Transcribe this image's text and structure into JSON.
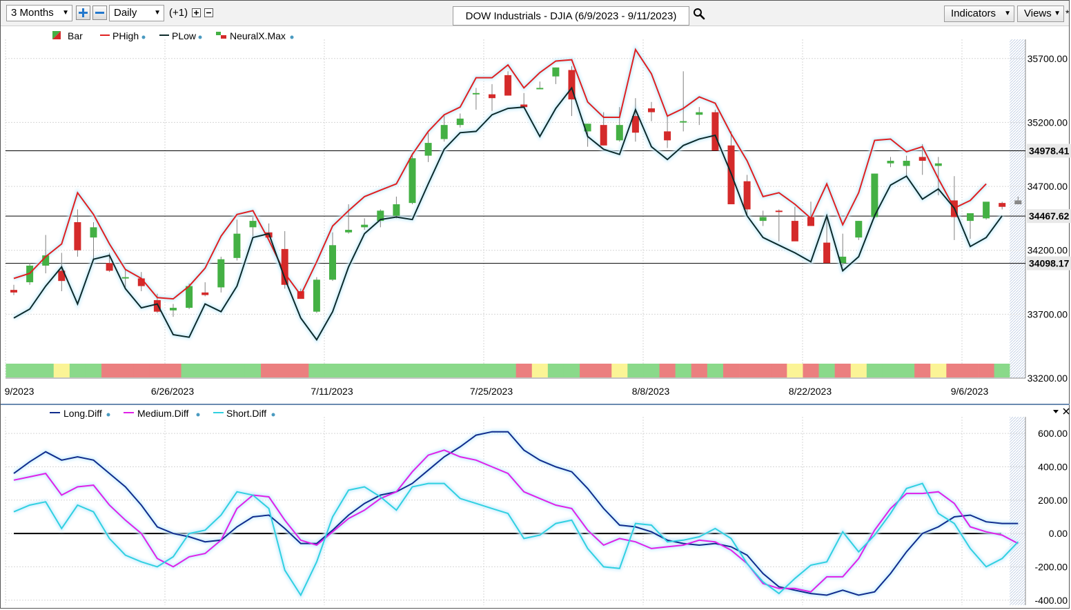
{
  "toolbar": {
    "period": "3 Months",
    "interval": "Daily",
    "step": "(+1)",
    "title": "DOW Industrials - DJIA (6/9/2023 - 9/11/2023)",
    "indicators_label": "Indicators",
    "views_label": "Views",
    "more_label": "*",
    "zoom_in_icon": "plus-icon",
    "zoom_out_icon": "minus-icon",
    "search_icon": "magnifier-icon"
  },
  "colors": {
    "up": "#44b044",
    "down": "#d42a2a",
    "phigh": "#e02020",
    "plow": "#0d2a2a",
    "long": "#102c8c",
    "medium": "#e020e8",
    "short": "#30d0e0",
    "band_green": "#8ad98a",
    "band_red": "#eb7f7f",
    "band_yellow": "#fbf496"
  },
  "chart_data": [
    {
      "type": "candlestick",
      "legend": [
        "Bar",
        "PHigh",
        "PLow",
        "NeuralX.Max"
      ],
      "x_tick_labels": [
        "9/2023",
        "6/26/2023",
        "7/11/2023",
        "7/25/2023",
        "8/8/2023",
        "8/22/2023",
        "9/6/2023"
      ],
      "y_tick_labels": [
        "35700.00",
        "35200.00",
        "34700.00",
        "34200.00",
        "33700.00",
        "33200.00"
      ],
      "ylim": [
        33200,
        35850
      ],
      "horizontal_lines": [
        {
          "label": "34978.41",
          "value": 34978.41
        },
        {
          "label": "34467.62",
          "value": 34467.62
        },
        {
          "label": "34098.17",
          "value": 34098.17
        }
      ],
      "dates": [
        "6/9",
        "6/12",
        "6/13",
        "6/14",
        "6/15",
        "6/16",
        "6/20",
        "6/21",
        "6/22",
        "6/23",
        "6/26",
        "6/27",
        "6/28",
        "6/29",
        "6/30",
        "7/3",
        "7/5",
        "7/6",
        "7/7",
        "7/10",
        "7/11",
        "7/12",
        "7/13",
        "7/14",
        "7/17",
        "7/18",
        "7/19",
        "7/20",
        "7/21",
        "7/24",
        "7/25",
        "7/26",
        "7/27",
        "7/28",
        "7/31",
        "8/1",
        "8/2",
        "8/3",
        "8/4",
        "8/7",
        "8/8",
        "8/9",
        "8/10",
        "8/11",
        "8/14",
        "8/15",
        "8/16",
        "8/17",
        "8/18",
        "8/21",
        "8/22",
        "8/23",
        "8/24",
        "8/25",
        "8/28",
        "8/29",
        "8/30",
        "8/31",
        "9/1",
        "9/5",
        "9/6",
        "9/7",
        "9/8",
        "9/11"
      ],
      "open": [
        33890,
        33950,
        34080,
        34040,
        34420,
        34300,
        34100,
        33980,
        33980,
        33810,
        33730,
        33750,
        33870,
        33910,
        34140,
        34380,
        34340,
        34210,
        33880,
        33720,
        33970,
        34340,
        34380,
        34430,
        34470,
        34570,
        34940,
        35070,
        35180,
        35430,
        35420,
        35570,
        35340,
        35470,
        35560,
        35610,
        35130,
        35180,
        35060,
        35250,
        35310,
        35130,
        35200,
        35260,
        35280,
        35020,
        34740,
        34430,
        34510,
        34430,
        34460,
        34260,
        34100,
        34300,
        34460,
        34880,
        34860,
        34930,
        34860,
        34590,
        34430,
        34450,
        34570,
        34590
      ],
      "high": [
        33930,
        34100,
        34320,
        34180,
        34520,
        34420,
        34180,
        34050,
        34030,
        33860,
        33780,
        33940,
        33950,
        34150,
        34440,
        34460,
        34410,
        34350,
        33900,
        33990,
        34340,
        34560,
        34450,
        34520,
        34620,
        34960,
        35120,
        35260,
        35270,
        35470,
        35500,
        35600,
        35430,
        35520,
        35630,
        35640,
        35190,
        35280,
        35320,
        35390,
        35360,
        35250,
        35600,
        35320,
        35300,
        35130,
        34790,
        34510,
        34520,
        34540,
        34580,
        34450,
        34330,
        34430,
        34800,
        34930,
        34940,
        35030,
        34930,
        34780,
        34470,
        34570,
        34580,
        34620
      ],
      "low": [
        33850,
        33930,
        34020,
        33880,
        34150,
        34130,
        34030,
        33910,
        33880,
        33710,
        33680,
        33740,
        33840,
        33870,
        34120,
        34310,
        34300,
        33900,
        33840,
        33710,
        33960,
        34330,
        34360,
        34380,
        34450,
        34560,
        34890,
        35050,
        35160,
        35300,
        35290,
        35410,
        35320,
        35460,
        35500,
        35250,
        35010,
        35020,
        35050,
        35050,
        35210,
        35000,
        35130,
        35180,
        35150,
        34940,
        34470,
        34390,
        34270,
        34320,
        34390,
        34110,
        34080,
        34280,
        34450,
        34850,
        34780,
        34790,
        34630,
        34280,
        34290,
        34440,
        34520,
        34560
      ],
      "close": [
        33870,
        34080,
        34160,
        33960,
        34200,
        34380,
        34040,
        33990,
        33920,
        33720,
        33750,
        33920,
        33850,
        34130,
        34330,
        34430,
        34300,
        33930,
        33820,
        33970,
        34240,
        34360,
        34400,
        34510,
        34560,
        34920,
        35040,
        35180,
        35230,
        35430,
        35390,
        35410,
        35320,
        35470,
        35630,
        35380,
        35190,
        35020,
        35180,
        35120,
        35280,
        35060,
        35210,
        35280,
        34980,
        34560,
        34520,
        34460,
        34500,
        34270,
        34390,
        34100,
        34150,
        34430,
        34800,
        34900,
        34900,
        34900,
        34880,
        34460,
        34490,
        34580,
        34540,
        34560
      ],
      "phigh": [
        33980,
        34020,
        34150,
        34250,
        34650,
        34480,
        34250,
        34050,
        33980,
        33830,
        33820,
        33920,
        34060,
        34310,
        34480,
        34510,
        34280,
        34020,
        33850,
        34110,
        34390,
        34510,
        34620,
        34670,
        34720,
        34950,
        35130,
        35260,
        35320,
        35550,
        35550,
        35650,
        35470,
        35590,
        35680,
        35690,
        35360,
        35240,
        35240,
        35770,
        35580,
        35250,
        35310,
        35400,
        35350,
        35110,
        34900,
        34620,
        34650,
        34560,
        34450,
        34720,
        34400,
        34650,
        35060,
        35070,
        34970,
        35010,
        34760,
        34530,
        34590,
        34720
      ],
      "plow": [
        33670,
        33740,
        33920,
        34070,
        33780,
        34130,
        34160,
        33900,
        33750,
        33780,
        33540,
        33520,
        33780,
        33720,
        33920,
        34300,
        34330,
        33980,
        33670,
        33500,
        33720,
        34070,
        34330,
        34440,
        34460,
        34440,
        34720,
        34990,
        35120,
        35130,
        35260,
        35310,
        35320,
        35090,
        35310,
        35470,
        35090,
        34990,
        34950,
        35300,
        35010,
        34910,
        35020,
        35070,
        35100,
        34800,
        34470,
        34300,
        34240,
        34180,
        34110,
        34470,
        34040,
        34150,
        34470,
        34710,
        34780,
        34600,
        34680,
        34530,
        34230,
        34300,
        34470
      ],
      "band": [
        "g",
        "g",
        "g",
        "y",
        "g",
        "g",
        "r",
        "r",
        "r",
        "r",
        "r",
        "g",
        "g",
        "g",
        "g",
        "g",
        "r",
        "r",
        "r",
        "g",
        "g",
        "g",
        "g",
        "g",
        "g",
        "g",
        "g",
        "g",
        "g",
        "g",
        "g",
        "g",
        "r",
        "y",
        "g",
        "g",
        "r",
        "r",
        "y",
        "g",
        "g",
        "r",
        "g",
        "r",
        "g",
        "r",
        "r",
        "r",
        "r",
        "y",
        "r",
        "g",
        "r",
        "y",
        "g",
        "g",
        "g",
        "r",
        "y",
        "r",
        "r",
        "r",
        "g",
        "g"
      ]
    },
    {
      "type": "line",
      "legend": [
        "Long.Diff",
        "Medium.Diff",
        "Short.Diff"
      ],
      "y_tick_labels": [
        "600.00",
        "400.00",
        "200.00",
        "0.00",
        "-200.00",
        "-400.00"
      ],
      "ylim": [
        -430,
        700
      ],
      "series": [
        {
          "name": "Long.Diff",
          "values": [
            360,
            430,
            490,
            440,
            460,
            440,
            360,
            280,
            170,
            40,
            0,
            -20,
            -50,
            -40,
            40,
            100,
            110,
            30,
            -60,
            -60,
            20,
            110,
            180,
            230,
            250,
            300,
            380,
            460,
            520,
            590,
            610,
            610,
            500,
            440,
            400,
            370,
            270,
            150,
            50,
            40,
            10,
            -40,
            -60,
            -70,
            -60,
            -80,
            -130,
            -240,
            -320,
            -340,
            -360,
            -370,
            -340,
            -370,
            -350,
            -240,
            -110,
            0,
            40,
            100,
            110,
            70,
            60,
            60
          ]
        },
        {
          "name": "Medium.Diff",
          "values": [
            320,
            340,
            360,
            230,
            280,
            290,
            170,
            80,
            0,
            -150,
            -200,
            -140,
            -120,
            -40,
            150,
            230,
            220,
            80,
            -40,
            -70,
            10,
            90,
            140,
            210,
            250,
            370,
            470,
            500,
            460,
            440,
            400,
            360,
            250,
            210,
            170,
            150,
            20,
            -70,
            -30,
            -50,
            -90,
            -80,
            -70,
            -40,
            -50,
            -100,
            -180,
            -300,
            -330,
            -330,
            -350,
            -260,
            -260,
            -150,
            20,
            150,
            240,
            240,
            250,
            180,
            40,
            10,
            -10,
            -60
          ]
        },
        {
          "name": "Short.Diff",
          "values": [
            130,
            170,
            190,
            30,
            170,
            130,
            -30,
            -130,
            -170,
            -200,
            -140,
            0,
            20,
            110,
            250,
            230,
            150,
            -220,
            -370,
            -170,
            100,
            260,
            280,
            220,
            140,
            280,
            300,
            300,
            210,
            180,
            150,
            120,
            -30,
            -10,
            60,
            80,
            -90,
            -200,
            -210,
            60,
            50,
            -50,
            -40,
            -20,
            30,
            -30,
            -180,
            -290,
            -360,
            -270,
            -190,
            -170,
            10,
            -110,
            -10,
            120,
            270,
            300,
            120,
            60,
            -90,
            -200,
            -150,
            -50
          ]
        }
      ],
      "zero_line": 0
    }
  ]
}
